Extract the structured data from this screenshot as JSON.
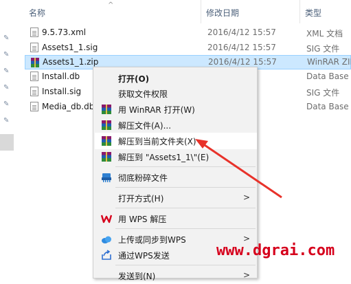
{
  "columns": {
    "name": "名称",
    "date": "修改日期",
    "type": "类型"
  },
  "files": [
    {
      "name": "9.5.73.xml",
      "date": "2016/4/12 15:57",
      "type": "XML 文档",
      "icon": "xml-file-icon"
    },
    {
      "name": "Assets1_1.sig",
      "date": "2016/4/12 15:57",
      "type": "SIG 文件",
      "icon": "generic-file-icon"
    },
    {
      "name": "Assets1_1.zip",
      "date": "2016/4/12 15:57",
      "type": "WinRAR ZIP",
      "icon": "winrar-icon",
      "selected": true
    },
    {
      "name": "Install.db",
      "date": "2016/4/12 15:57",
      "type": "Data Base",
      "icon": "db-file-icon"
    },
    {
      "name": "Install.sig",
      "date": "2016/4/12 15:57",
      "type": "SIG 文件",
      "icon": "generic-file-icon"
    },
    {
      "name": "Media_db.db",
      "date": "2016/4/12 15:57",
      "type": "Data Base",
      "icon": "db-file-icon"
    }
  ],
  "menu": {
    "open": "打开(O)",
    "take_ownership": "获取文件权限",
    "open_winrar": "用 WinRAR 打开(W)",
    "extract_files": "解压文件(A)...",
    "extract_here": "解压到当前文件夹(X)",
    "extract_to": "解压到 \"Assets1_1\\\"(E)",
    "shred": "彻底粉碎文件",
    "open_with": "打开方式(H)",
    "wps_extract": "用 WPS 解压",
    "upload_wps": "上传或同步到WPS",
    "send_wps": "通过WPS发送",
    "send_to": "发送到(N)"
  },
  "watermark": "www.dgrai.com",
  "colors": {
    "accent_red": "#d6001c",
    "selection": "#cce8ff",
    "header_text": "#4c607a"
  }
}
